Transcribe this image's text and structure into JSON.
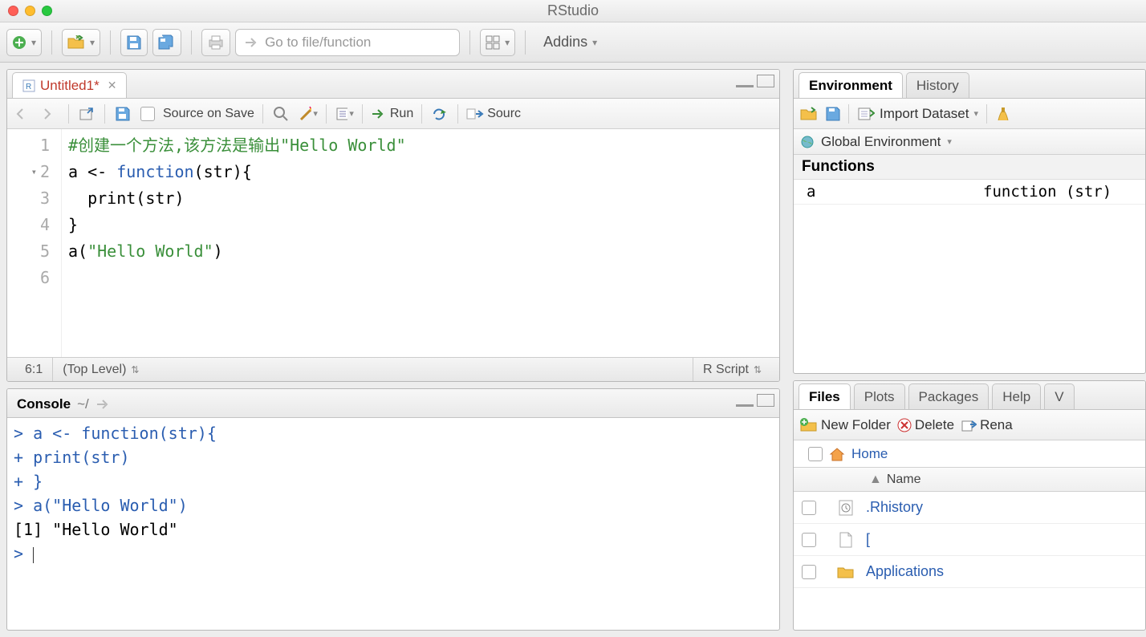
{
  "app": {
    "title": "RStudio"
  },
  "main_toolbar": {
    "goto_placeholder": "Go to file/function",
    "addins_label": "Addins"
  },
  "source_pane": {
    "tab": {
      "label": "Untitled1",
      "dirty_marker": "*"
    },
    "toolbar": {
      "source_on_save": "Source on Save",
      "run": "Run",
      "source": "Sourc"
    },
    "gutter": [
      "1",
      "2",
      "3",
      "4",
      "5",
      "6"
    ],
    "code": {
      "line1_comment": "#创建一个方法,该方法是输出\"Hello World\"",
      "line2_pre": "a <- ",
      "line2_kw": "function",
      "line2_post": "(str){",
      "line3": "  print(str)",
      "line4": "}",
      "line5_pre": "a(",
      "line5_str": "\"Hello World\"",
      "line5_post": ")"
    },
    "status": {
      "cursor": "6:1",
      "scope": "(Top Level)",
      "lang": "R Script"
    }
  },
  "console_pane": {
    "title": "Console",
    "path": "~/",
    "lines": {
      "l1": "> a <- function(str){",
      "l2": "+   print(str)",
      "l3": "+ }",
      "l4": "> a(\"Hello World\")",
      "l5": "[1] \"Hello World\"",
      "l6": "> "
    }
  },
  "env_pane": {
    "tabs": {
      "env": "Environment",
      "hist": "History"
    },
    "toolbar": {
      "import": "Import Dataset"
    },
    "scope": "Global Environment",
    "section": "Functions",
    "rows": [
      {
        "name": "a",
        "value": "function (str)"
      }
    ]
  },
  "files_pane": {
    "tabs": {
      "files": "Files",
      "plots": "Plots",
      "packages": "Packages",
      "help": "Help",
      "viewer": "V"
    },
    "toolbar": {
      "new_folder": "New Folder",
      "delete": "Delete",
      "rename": "Rena"
    },
    "crumb": "Home",
    "header": {
      "name": "Name"
    },
    "rows": [
      {
        "label": ".Rhistory",
        "icon": "history-file-icon"
      },
      {
        "label": "[",
        "icon": "file-icon"
      },
      {
        "label": "Applications",
        "icon": "folder-icon"
      }
    ]
  }
}
